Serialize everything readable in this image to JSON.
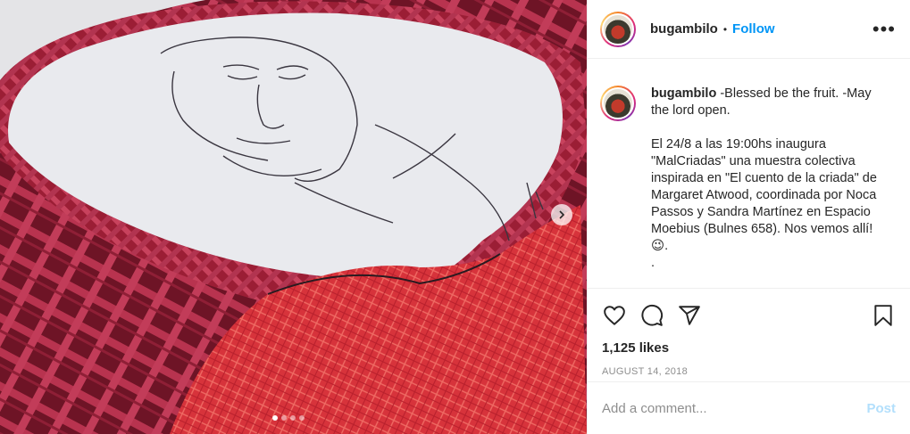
{
  "post": {
    "username": "bugambilo",
    "separator": "•",
    "follow_label": "Follow",
    "more_icon": "more-options-icon",
    "caption_lead": "-Blessed be the fruit. -May the lord open.",
    "caption_body": "El 24/8 a las 19:00hs inaugura \"MalCriadas\" una muestra colectiva inspirada en \"El cuento de la criada\" de Margaret Atwood, coordinada por Noca Passos y Sandra Martínez en Espacio Moebius (Bulnes 658). Nos vemos allí! 😉.\n.",
    "likes": "1,125 likes",
    "date": "AUGUST 14, 2018",
    "comment_placeholder": "Add a comment...",
    "post_label": "Post"
  },
  "carousel": {
    "slide_count": 4,
    "active_index": 0
  },
  "icons": {
    "like": "heart-icon",
    "comment": "comment-icon",
    "share": "share-icon",
    "save": "bookmark-icon",
    "next": "chevron-right-icon"
  },
  "colors": {
    "accent": "#0095f6",
    "post_disabled": "#b2dffc",
    "muted": "#8e8e8e",
    "text": "#262626"
  }
}
